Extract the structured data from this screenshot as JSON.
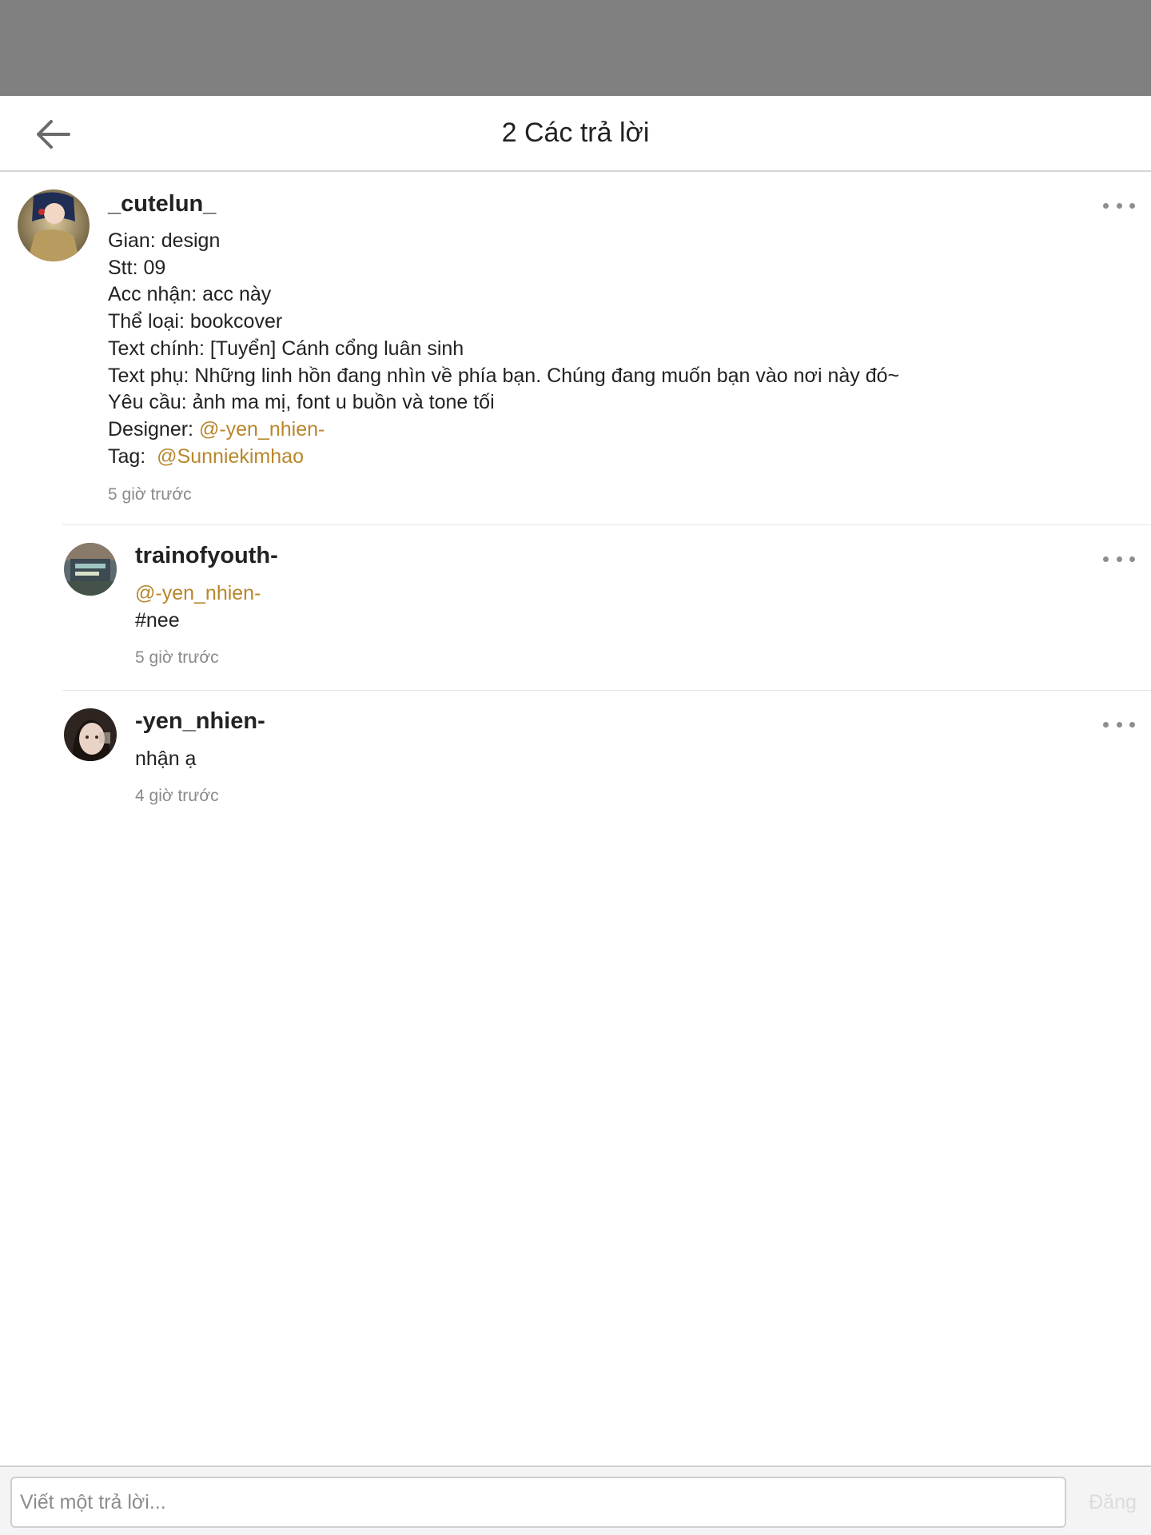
{
  "header": {
    "title": "2 Các trả lời"
  },
  "parent": {
    "username": "_cutelun_",
    "lines": [
      "Gian: design",
      "Stt: 09",
      "Acc nhận: acc này",
      "Thể loại: bookcover",
      "Text chính: [Tuyển] Cánh cổng luân sinh",
      "Text phụ: Những linh hồn đang nhìn về phía bạn. Chúng đang muốn bạn vào nơi này đó~",
      "Yêu cầu: ảnh ma mị, font u buồn và tone tối"
    ],
    "designer_label": "Designer: ",
    "designer_mention": "@-yen_nhien-",
    "tag_label": "Tag:  ",
    "tag_mention": "@Sunniekimhao",
    "time": "5 giờ trước"
  },
  "replies": [
    {
      "username": "trainofyouth-",
      "mention": "@-yen_nhien-",
      "text": "#nee",
      "time": "5 giờ trước"
    },
    {
      "username": "-yen_nhien-",
      "text": "nhận ạ",
      "time": "4 giờ trước"
    }
  ],
  "composer": {
    "placeholder": "Viết một trả lời...",
    "post_label": "Đăng"
  },
  "colors": {
    "mention": "#b8862b",
    "statusbar": "#808080",
    "timestamp": "#8a8a8a"
  },
  "icons": {
    "back": "arrow-left-icon",
    "more": "more-horizontal-icon"
  }
}
